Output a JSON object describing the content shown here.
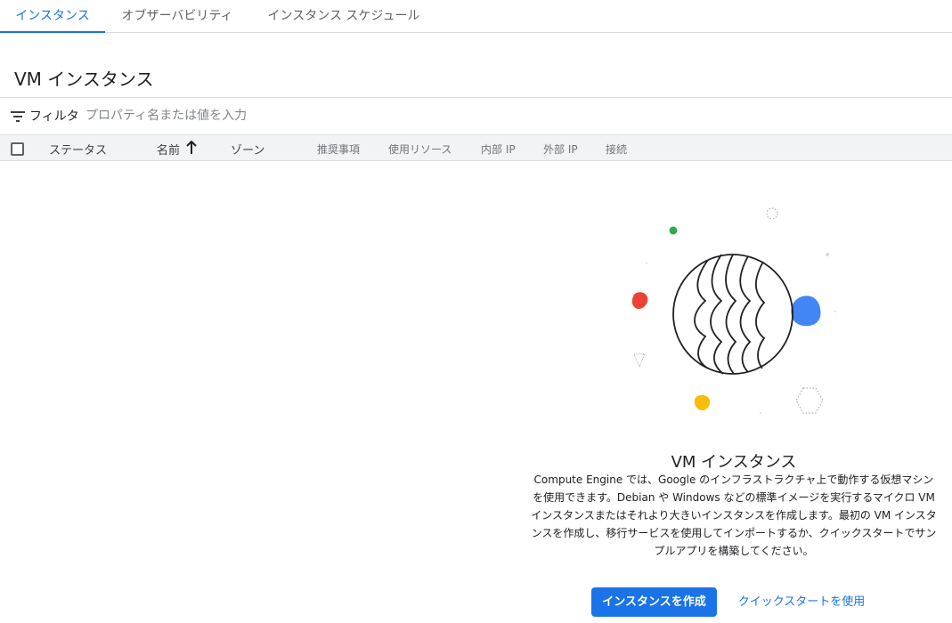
{
  "tabs": [
    {
      "label": "インスタンス",
      "active": true
    },
    {
      "label": "オブザーバビリティ",
      "active": false
    },
    {
      "label": "インスタンス スケジュール",
      "active": false
    }
  ],
  "page": {
    "title": "VM インスタンス"
  },
  "filter": {
    "label": "フィルタ",
    "placeholder": "プロパティ名または値を入力",
    "icon": "filter-icon"
  },
  "table": {
    "columns": [
      "ステータス",
      "名前",
      "ゾーン",
      "推奨事項",
      "使用リソース",
      "内部 IP",
      "外部 IP",
      "接続"
    ],
    "sort_column": "名前",
    "sort_direction": "ascending"
  },
  "empty_state": {
    "title": "VM インスタンス",
    "description": "Compute Engine では、Google のインフラストラクチャ上で動作する仮想マシンを使用できます。Debian や Windows などの標準イメージを実行するマイクロ VM インスタンスまたはそれより大きいインスタンスを作成します。最初の VM インスタンスを作成し、移行サービスを使用してインポートするか、クイックスタートでサンプルアプリを構築してください。",
    "primary_button": "インスタンスを作成",
    "secondary_button": "クイックスタートを使用"
  },
  "colors": {
    "accent": "#1a73e8",
    "green": "#34a853",
    "red": "#ea4335",
    "blue": "#4285f4",
    "yellow": "#fbbc04"
  }
}
